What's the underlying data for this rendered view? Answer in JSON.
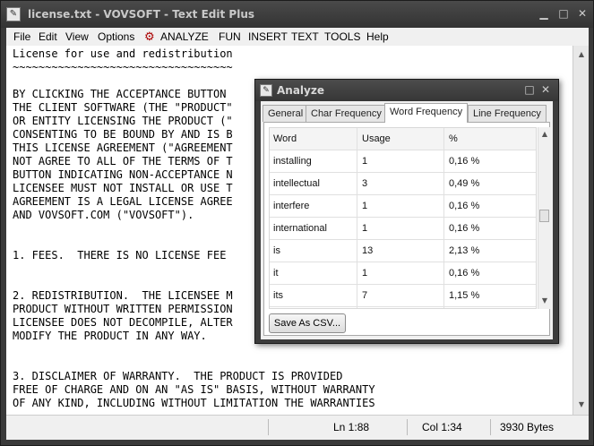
{
  "window": {
    "title": "license.txt - VOVSOFT - Text Edit Plus",
    "icon": "app-pen-icon"
  },
  "menu": [
    "File",
    "Edit",
    "View",
    "Options",
    "ANALYZE",
    "FUN",
    "INSERT",
    "TEXT",
    "TOOLS",
    "Help"
  ],
  "editor_lines": [
    "License for use and redistribution",
    "~~~~~~~~~~~~~~~~~~~~~~~~~~~~~~~~~~",
    "",
    "BY CLICKING THE ACCEPTANCE BUTTON",
    "THE CLIENT SOFTWARE (THE \"PRODUCT\"",
    "OR ENTITY LICENSING THE PRODUCT (\"",
    "CONSENTING TO BE BOUND BY AND IS B",
    "THIS LICENSE AGREEMENT (\"AGREEMENT",
    "NOT AGREE TO ALL OF THE TERMS OF T",
    "BUTTON INDICATING NON-ACCEPTANCE N",
    "LICENSEE MUST NOT INSTALL OR USE T",
    "AGREEMENT IS A LEGAL LICENSE AGREE",
    "AND VOVSOFT.COM (\"VOVSOFT\").",
    "",
    "",
    "1. FEES.  THERE IS NO LICENSE FEE",
    "",
    "",
    "2. REDISTRIBUTION.  THE LICENSEE M",
    "PRODUCT WITHOUT WRITTEN PERMISSION",
    "LICENSEE DOES NOT DECOMPILE, ALTER",
    "MODIFY THE PRODUCT IN ANY WAY.",
    "",
    "",
    "3. DISCLAIMER OF WARRANTY.  THE PRODUCT IS PROVIDED",
    "FREE OF CHARGE AND ON AN \"AS IS\" BASIS, WITHOUT WARRANTY",
    "OF ANY KIND, INCLUDING WITHOUT LIMITATION THE WARRANTIES"
  ],
  "status": {
    "position": "Ln 1:88",
    "column": "Col 1:34",
    "size": "3930 Bytes"
  },
  "analyze": {
    "title": "Analyze",
    "tabs": [
      "General",
      "Char Frequency",
      "Word Frequency",
      "Line Frequency"
    ],
    "active_tab": "Word Frequency",
    "columns": [
      "Word",
      "Usage",
      "%"
    ],
    "rows": [
      [
        "installing",
        "1",
        "0,16 %"
      ],
      [
        "intellectual",
        "3",
        "0,49 %"
      ],
      [
        "interfere",
        "1",
        "0,16 %"
      ],
      [
        "international",
        "1",
        "0,16 %"
      ],
      [
        "is",
        "13",
        "2,13 %"
      ],
      [
        "it",
        "1",
        "0,16 %"
      ],
      [
        "its",
        "7",
        "1,15 %"
      ]
    ],
    "save_button": "Save As CSV..."
  }
}
